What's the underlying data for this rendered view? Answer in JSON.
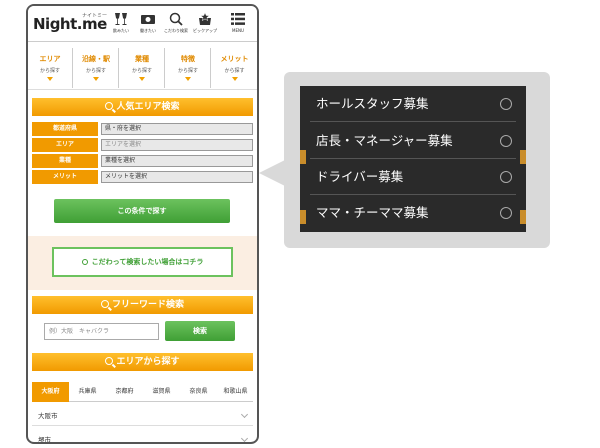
{
  "header": {
    "logo": "Night.me",
    "logo_kana": "ナイトミー",
    "nav": [
      {
        "icon": "wine-glasses-icon",
        "label": "飲みたい"
      },
      {
        "icon": "money-icon",
        "label": "働きたい"
      },
      {
        "icon": "search-icon",
        "label": "こだわり検索"
      },
      {
        "icon": "star-bag-icon",
        "label": "ピックアップ"
      },
      {
        "icon": "menu-icon",
        "label": "MENU"
      }
    ]
  },
  "categories": [
    {
      "title": "エリア",
      "sub": "から探す"
    },
    {
      "title": "沿線・駅",
      "sub": "から探す"
    },
    {
      "title": "業種",
      "sub": "から探す"
    },
    {
      "title": "特徴",
      "sub": "から探す"
    },
    {
      "title": "メリット",
      "sub": "から探す"
    }
  ],
  "popular_search": {
    "heading": "人気エリア検索",
    "rows": [
      {
        "label": "都道府県",
        "value": "県・府を選択"
      },
      {
        "label": "エリア",
        "value": "エリアを選択"
      },
      {
        "label": "業種",
        "value": "業種を選択"
      },
      {
        "label": "メリット",
        "value": "メリットを選択"
      }
    ],
    "submit": "この条件で探す"
  },
  "kodawari_button": "こだわって検索したい場合はコチラ",
  "freeword": {
    "heading": "フリーワード検索",
    "placeholder": "例）大阪　キャバクラ",
    "button": "検索"
  },
  "area_search": {
    "heading": "エリアから探す",
    "prefectures": [
      "大阪府",
      "兵庫県",
      "京都府",
      "滋賀県",
      "奈良県",
      "和歌山県"
    ],
    "active_index": 0,
    "cities": [
      "大阪市",
      "堺市"
    ]
  },
  "callout": {
    "options": [
      "ホールスタッフ募集",
      "店長・マネージャー募集",
      "ドライバー募集",
      "ママ・チーママ募集"
    ]
  },
  "colors": {
    "accent_orange": "#f19a00",
    "accent_green": "#3f9f35",
    "dropdown_bg": "#2a2a2a"
  }
}
